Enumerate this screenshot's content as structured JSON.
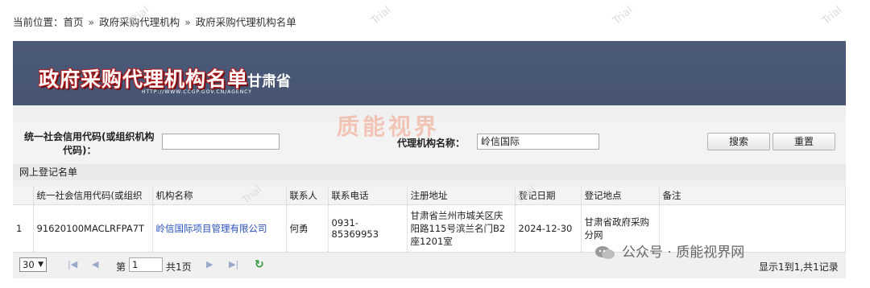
{
  "breadcrumb": {
    "prefix": "当前位置：",
    "home": "首页",
    "sep1": "»",
    "level1": "政府采购代理机构",
    "sep2": "»",
    "level2": "政府采购代理机构名单"
  },
  "banner": {
    "title": "政府采购代理机构名单",
    "province": "甘肃省",
    "url": "HTTP://WWW.CCGP.GOV.CN/AGENCY"
  },
  "search": {
    "credit_label_line1": "统一社会信用代码(或组织机构",
    "credit_label_line2": "代码)：",
    "credit_value": "",
    "agency_label": "代理机构名称：",
    "agency_value": "岭信国际",
    "search_button": "搜索",
    "reset_button": "重置"
  },
  "section_title": "网上登记名单",
  "table": {
    "headers": [
      "",
      "统一社会信用代码(或组织",
      "机构名称",
      "联系人",
      "联系电话",
      "注册地址",
      "登记日期",
      "登记地点",
      "备注"
    ],
    "rows": [
      {
        "index": "1",
        "code": "91620100MACLRFPA7T",
        "name": "岭信国际项目管理有限公司",
        "contact": "何勇",
        "phone": "0931-85369953",
        "address": "甘肃省兰州市城关区庆阳路115号滨兰名门B2座1201室",
        "date": "2024-12-30",
        "location": "甘肃省政府采购分网",
        "remark": ""
      }
    ]
  },
  "pager": {
    "page_size": "30",
    "page_prefix": "第",
    "page_value": "1",
    "page_suffix": "共1页",
    "summary": "显示1到1,共1记录"
  },
  "overlays": {
    "watermark": "Trial",
    "stamp": "质能视界",
    "wechat": "公众号 · 质能视界网"
  },
  "colors": {
    "banner_bg": "#4a5877",
    "title_shadow": "#b01818",
    "link": "#2a52be",
    "refresh": "#2e9a3a"
  },
  "icons": {
    "first": "first-page-icon",
    "prev": "prev-page-icon",
    "next": "next-page-icon",
    "last": "last-page-icon",
    "refresh": "refresh-icon"
  }
}
